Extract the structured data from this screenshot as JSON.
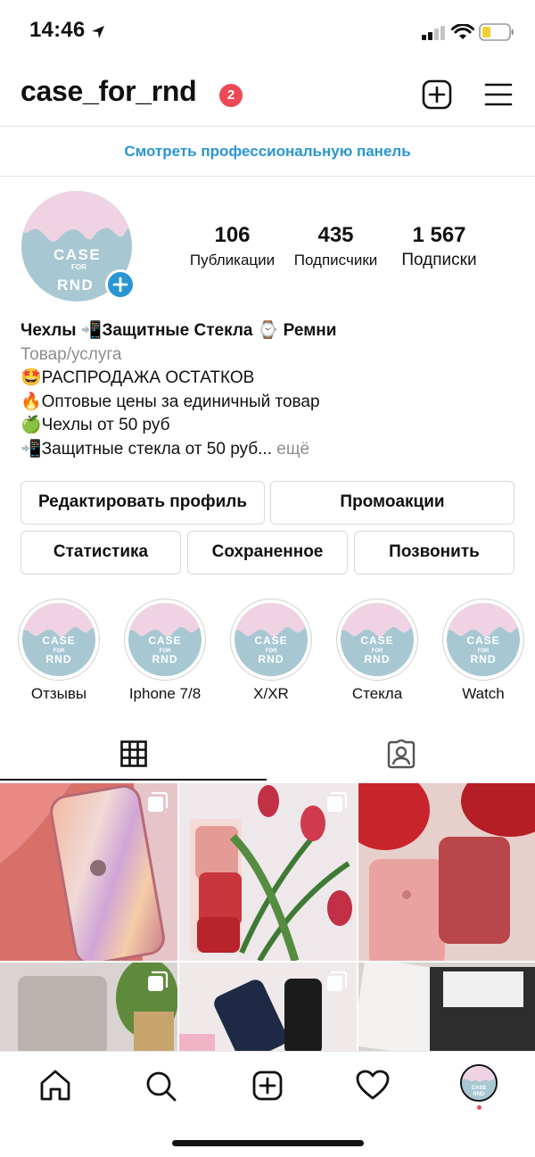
{
  "status_bar": {
    "time": "14:46",
    "icons": [
      "location-arrow-icon",
      "signal-icon",
      "wifi-icon",
      "battery-low-icon"
    ]
  },
  "header": {
    "username": "case_for_rnd",
    "notification_count": "2",
    "icons": [
      "new-post-icon",
      "menu-icon"
    ]
  },
  "professional_dashboard": "Смотреть профессиональную панель",
  "profile": {
    "avatar_text": [
      "CASE",
      "FOR",
      "RND"
    ],
    "stats": [
      {
        "value": "106",
        "label": "Публикации"
      },
      {
        "value": "435",
        "label": "Подписчики"
      },
      {
        "value": "1 567",
        "label": "Подписки"
      }
    ],
    "bio": {
      "name": "Чехлы 📲Защитные Стекла ⌚️ Ремни",
      "category": "Товар/услуга",
      "lines": [
        "🤩РАСПРОДАЖА ОСТАТКОВ",
        "🔥Оптовые цены за единичный товар",
        "🍏Чехлы от 50 руб",
        "📲Защитные стекла от 50 руб..."
      ],
      "more": " ещё"
    }
  },
  "buttons": {
    "edit_profile": "Редактировать профиль",
    "promotions": "Промоакции",
    "statistics": "Статистика",
    "saved": "Сохраненное",
    "call": "Позвонить"
  },
  "highlights": [
    {
      "label": "Отзывы"
    },
    {
      "label": "Iphone 7/8"
    },
    {
      "label": "X/XR"
    },
    {
      "label": "Стекла"
    },
    {
      "label": "Watch"
    }
  ],
  "tabs": [
    {
      "icon": "grid-icon",
      "active": true
    },
    {
      "icon": "tagged-icon",
      "active": false
    }
  ],
  "posts": [
    {
      "desc": "holographic pink iphone case"
    },
    {
      "desc": "pink and red silicone cases with tulips"
    },
    {
      "desc": "pink silicone iphone 7/8 case"
    },
    {
      "desc": "grey iphone x case"
    },
    {
      "desc": "black and navy cases"
    },
    {
      "desc": "pro+ glass packaging"
    }
  ],
  "bottom_nav": [
    "home-icon",
    "search-icon",
    "create-icon",
    "activity-heart-icon",
    "profile-avatar-icon"
  ],
  "colors": {
    "accent_blue": "#2a95d3",
    "badge_red": "#ed4956",
    "avatar_pink": "#efd3e3",
    "avatar_blue": "#a7c8d3"
  }
}
